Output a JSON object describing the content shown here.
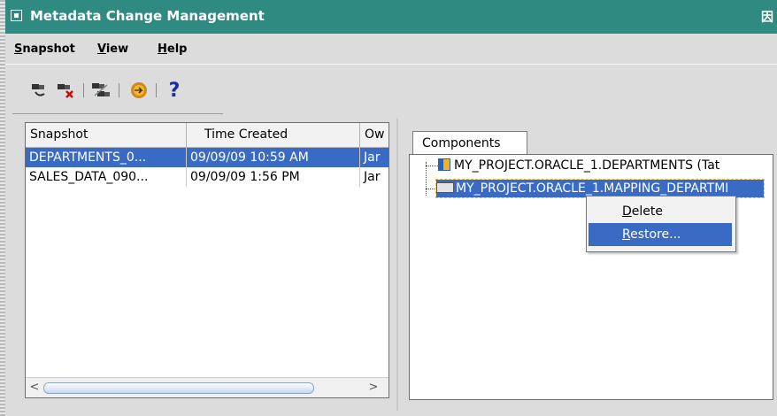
{
  "window": {
    "title": "Metadata Change Management",
    "title_right_glyph": "因"
  },
  "menu": [
    {
      "label": "Snapshot",
      "mnemonic": "S"
    },
    {
      "label": "View",
      "mnemonic": "V"
    },
    {
      "label": "Help",
      "mnemonic": "H"
    }
  ],
  "toolbar": {
    "icons": [
      "create-snapshot-icon",
      "delete-snapshot-icon",
      "compare-snapshots-icon",
      "export-icon",
      "help-icon"
    ],
    "help_glyph": "?"
  },
  "snapshots": {
    "columns": [
      "Snapshot",
      "Time Created",
      "Ow"
    ],
    "rows": [
      {
        "name": "DEPARTMENTS_0...",
        "time": "09/09/09 10:59 AM",
        "owner": "Jar",
        "selected": true
      },
      {
        "name": "SALES_DATA_090...",
        "time": "09/09/09 1:56 PM",
        "owner": "Jar",
        "selected": false
      }
    ],
    "scroll_left": "<",
    "scroll_right": ">"
  },
  "components": {
    "tab_label": "Components",
    "nodes": [
      {
        "label": "MY_PROJECT.ORACLE_1.DEPARTMENTS (Tat",
        "icon": "table-icon",
        "selected": false
      },
      {
        "label": "MY_PROJECT.ORACLE_1.MAPPING_DEPARTMI",
        "icon": "folder-icon",
        "selected": true
      }
    ]
  },
  "context_menu": {
    "items": [
      {
        "label": "Delete",
        "mnemonic": "D",
        "active": false
      },
      {
        "label": "Restore...",
        "mnemonic": "R",
        "active": true
      }
    ]
  },
  "colors": {
    "titlebar": "#2f8a82",
    "selection": "#3a6bc4"
  }
}
